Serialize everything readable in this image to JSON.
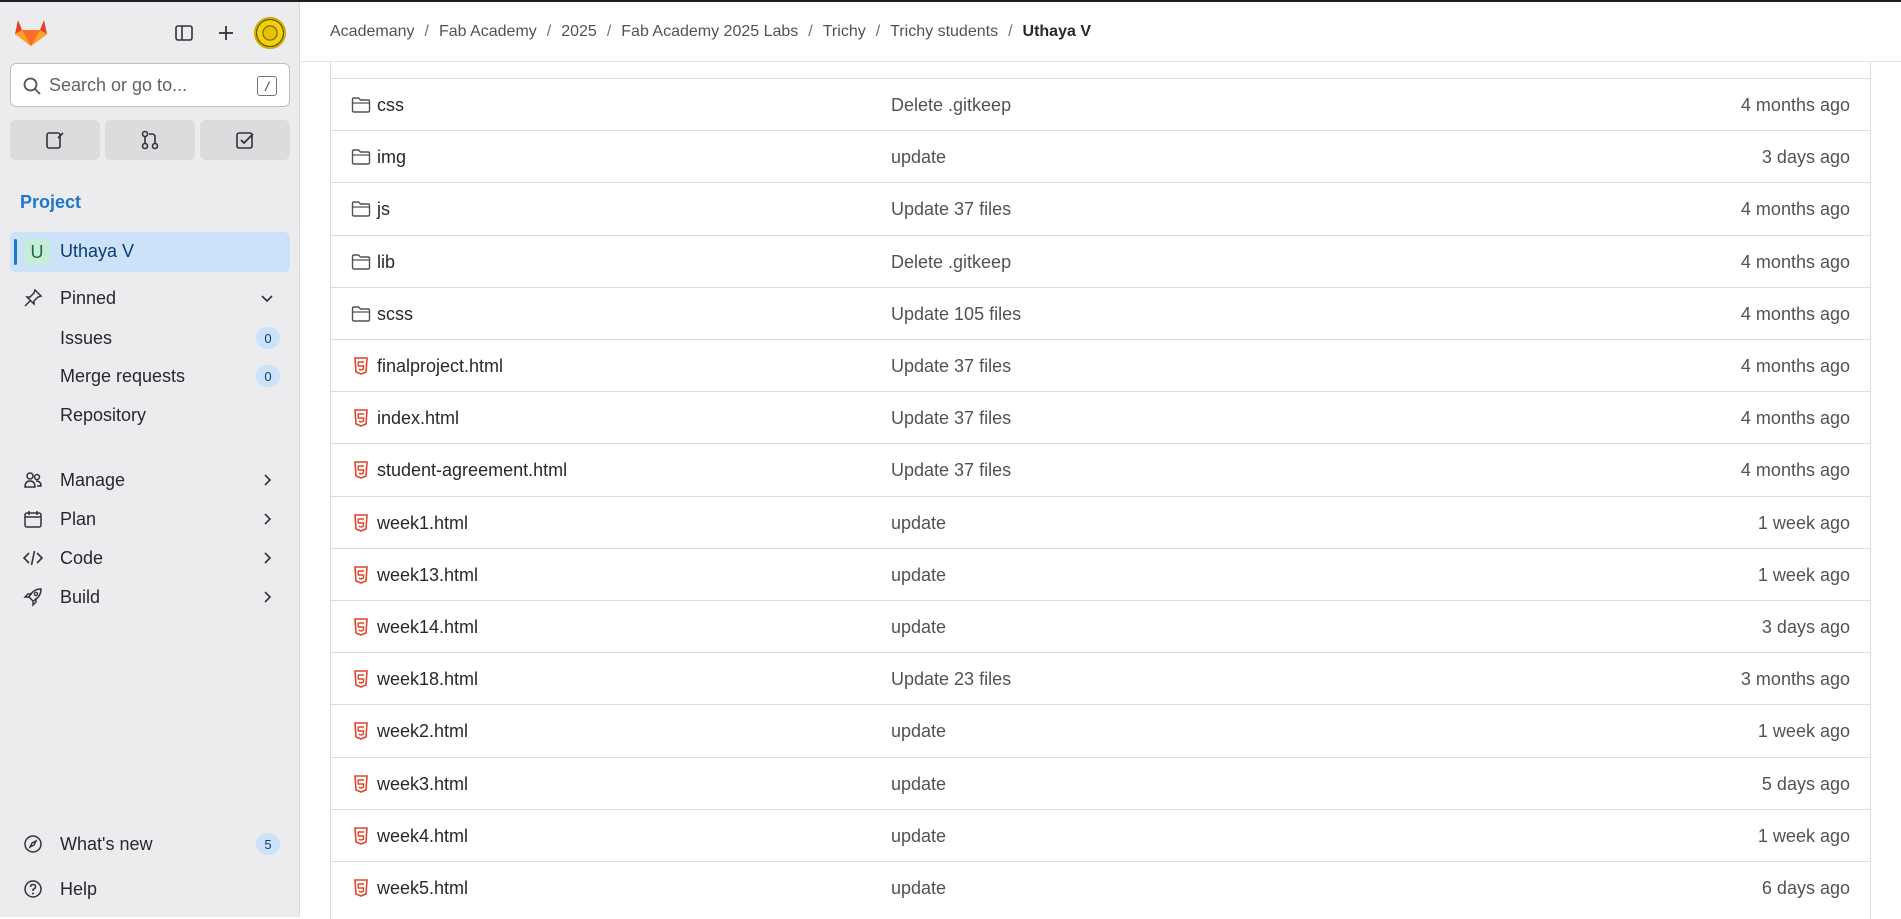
{
  "brand_color": "#fc6d26",
  "sidebar": {
    "search_placeholder": "Search or go to...",
    "search_shortcut": "/",
    "section_label": "Project",
    "project": {
      "initial": "U",
      "name": "Uthaya V"
    },
    "pinned": {
      "label": "Pinned",
      "items": [
        {
          "label": "Issues",
          "count": "0"
        },
        {
          "label": "Merge requests",
          "count": "0"
        },
        {
          "label": "Repository"
        }
      ]
    },
    "nav": [
      {
        "label": "Manage",
        "icon": "users-icon"
      },
      {
        "label": "Plan",
        "icon": "calendar-icon"
      },
      {
        "label": "Code",
        "icon": "code-icon"
      },
      {
        "label": "Build",
        "icon": "rocket-icon"
      }
    ],
    "footer": {
      "whats_new": "What's new",
      "whats_new_count": "5",
      "help": "Help"
    }
  },
  "breadcrumbs": [
    "Academany",
    "Fab Academy",
    "2025",
    "Fab Academy 2025 Labs",
    "Trichy",
    "Trichy students",
    "Uthaya V"
  ],
  "files": [
    {
      "type": "folder",
      "name": "css",
      "commit": "Delete .gitkeep",
      "date": "4 months ago"
    },
    {
      "type": "folder",
      "name": "img",
      "commit": "update",
      "date": "3 days ago"
    },
    {
      "type": "folder",
      "name": "js",
      "commit": "Update 37 files",
      "date": "4 months ago"
    },
    {
      "type": "folder",
      "name": "lib",
      "commit": "Delete .gitkeep",
      "date": "4 months ago"
    },
    {
      "type": "folder",
      "name": "scss",
      "commit": "Update 105 files",
      "date": "4 months ago"
    },
    {
      "type": "html",
      "name": "finalproject.html",
      "commit": "Update 37 files",
      "date": "4 months ago"
    },
    {
      "type": "html",
      "name": "index.html",
      "commit": "Update 37 files",
      "date": "4 months ago"
    },
    {
      "type": "html",
      "name": "student-agreement.html",
      "commit": "Update 37 files",
      "date": "4 months ago"
    },
    {
      "type": "html",
      "name": "week1.html",
      "commit": "update",
      "date": "1 week ago"
    },
    {
      "type": "html",
      "name": "week13.html",
      "commit": "update",
      "date": "1 week ago"
    },
    {
      "type": "html",
      "name": "week14.html",
      "commit": "update",
      "date": "3 days ago"
    },
    {
      "type": "html",
      "name": "week18.html",
      "commit": "Update 23 files",
      "date": "3 months ago"
    },
    {
      "type": "html",
      "name": "week2.html",
      "commit": "update",
      "date": "1 week ago"
    },
    {
      "type": "html",
      "name": "week3.html",
      "commit": "update",
      "date": "5 days ago"
    },
    {
      "type": "html",
      "name": "week4.html",
      "commit": "update",
      "date": "1 week ago"
    },
    {
      "type": "html",
      "name": "week5.html",
      "commit": "update",
      "date": "6 days ago"
    }
  ]
}
